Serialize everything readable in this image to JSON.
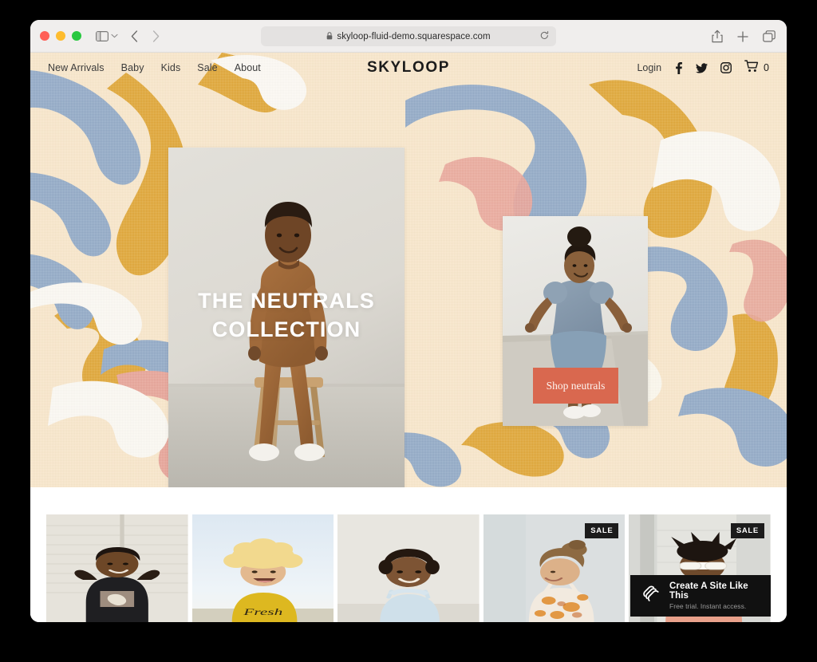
{
  "browser": {
    "url": "skyloop-fluid-demo.squarespace.com",
    "lock_icon": "lock-icon",
    "reload_icon": "reload-icon",
    "sidebar_icon": "sidebar-toggle-icon",
    "sidebar_chevron_icon": "chevron-down-icon",
    "back_icon": "back-arrow-icon",
    "forward_icon": "forward-arrow-icon",
    "share_icon": "share-icon",
    "new_tab_icon": "plus-icon",
    "tabs_icon": "tab-overview-icon",
    "traffic_lights": [
      "close-red",
      "minimize-yellow",
      "zoom-green"
    ]
  },
  "site": {
    "brand": "SKYLOOP",
    "nav": [
      {
        "label": "New Arrivals"
      },
      {
        "label": "Baby"
      },
      {
        "label": "Kids"
      },
      {
        "label": "Sale"
      },
      {
        "label": "About"
      }
    ],
    "account": {
      "login_label": "Login"
    },
    "social": [
      {
        "name": "facebook-icon"
      },
      {
        "name": "twitter-icon"
      },
      {
        "name": "instagram-icon"
      }
    ],
    "cart": {
      "icon": "shopping-cart-icon",
      "count": "0"
    }
  },
  "hero": {
    "headline_line1": "THE NEUTRALS",
    "headline_line2": "COLLECTION",
    "cta_label": "Shop neutrals",
    "cta_color": "#d9684f",
    "background_colors": {
      "canvas": "#f9e7ca",
      "gold": "#dfa32c",
      "blue": "#8ca6c6",
      "salmon": "#e8a195",
      "white": "#fdfbf6"
    }
  },
  "products": [
    {
      "name": "product-1",
      "badge": ""
    },
    {
      "name": "product-2",
      "badge": ""
    },
    {
      "name": "product-3",
      "badge": ""
    },
    {
      "name": "product-4",
      "badge": "SALE"
    },
    {
      "name": "product-5",
      "badge": "SALE"
    }
  ],
  "promo": {
    "title": "Create A Site Like This",
    "subtitle": "Free trial. Instant access.",
    "logo_icon": "squarespace-logo-icon"
  }
}
